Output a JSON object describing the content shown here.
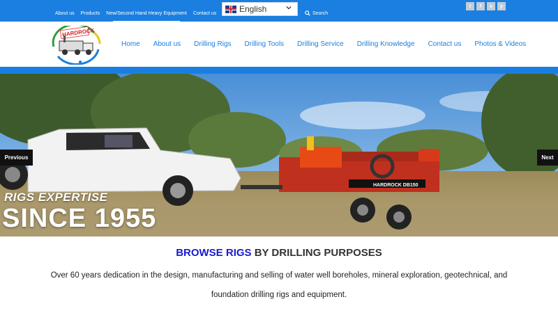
{
  "topbar": {
    "links": [
      "About us",
      "Products",
      "New/Second Hand Heavy Equipment",
      "Contact us"
    ],
    "language": "English",
    "search_label": "Search",
    "social": [
      "t",
      "f",
      "v",
      "y"
    ]
  },
  "logo": {
    "text": "HARDROCK"
  },
  "nav": {
    "items": [
      "Home",
      "About us",
      "Drilling Rigs",
      "Drilling Tools",
      "Drilling Service",
      "Drilling Knowledge",
      "Contact us",
      "Photos & Videos"
    ]
  },
  "hero": {
    "line1": "RIGS EXPERTISE",
    "line2": "SINCE 1955",
    "prev_label": "Previous",
    "next_label": "Next",
    "rig_label": "HARDROCK DB150"
  },
  "content": {
    "browse_highlight": "BROWSE RIGS",
    "browse_rest": " BY DRILLING PURPOSES",
    "desc_line1": "Over 60 years dedication in the design, manufacturing and selling of water well boreholes, mineral exploration, geotechnical, and",
    "desc_line2": "foundation drilling rigs and equipment."
  },
  "colors": {
    "brand_blue": "#1a7fe0",
    "browse_blue": "#1a1acc"
  }
}
